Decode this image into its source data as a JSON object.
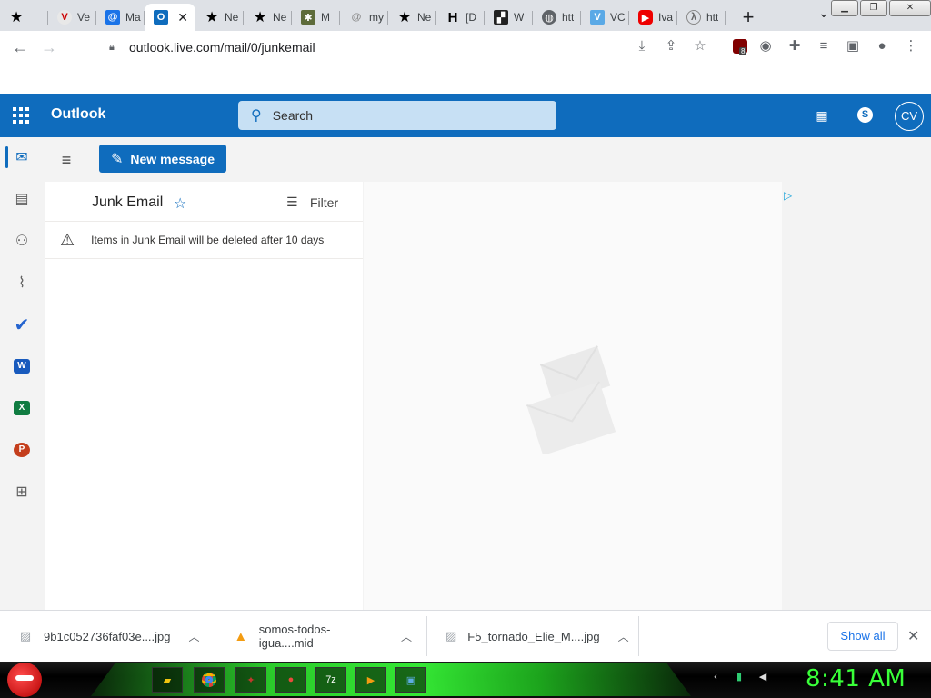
{
  "browser": {
    "tabs": [
      {
        "label": "",
        "icon": "star-icon"
      },
      {
        "label": "Ve",
        "icon": "vivaldi-icon"
      },
      {
        "label": "Ma",
        "icon": "at-mail-icon"
      },
      {
        "label": "",
        "icon": "outlook-icon",
        "active": true
      },
      {
        "label": "Ne",
        "icon": "star-icon"
      },
      {
        "label": "Ne",
        "icon": "star-icon"
      },
      {
        "label": "M",
        "icon": "bug-icon"
      },
      {
        "label": "my",
        "icon": "at-icon"
      },
      {
        "label": "Ne",
        "icon": "star-icon"
      },
      {
        "label": "[D",
        "icon": "h-letter-icon"
      },
      {
        "label": "W",
        "icon": "clapperboard-icon"
      },
      {
        "label": "htt",
        "icon": "globe-icon"
      },
      {
        "label": "VC",
        "icon": "v-letter-icon"
      },
      {
        "label": "Iva",
        "icon": "youtube-icon"
      },
      {
        "label": "htt",
        "icon": "lambda-icon"
      }
    ],
    "url": "outlook.live.com/mail/0/junkemail",
    "extension_badge": "8"
  },
  "outlook": {
    "brand": "Outlook",
    "search_placeholder": "Search",
    "avatar_initials": "CV",
    "new_message_label": "New message",
    "folder_title": "Junk Email",
    "filter_label": "Filter",
    "notice": "Items in Junk Email will be deleted after 10 days",
    "colors": {
      "header": "#0f6cbd",
      "search_bg": "#c7e0f4"
    }
  },
  "downloads": {
    "items": [
      {
        "name": "9b1c052736faf03e....jpg",
        "icon": "image-file-icon"
      },
      {
        "name": "somos-todos-igua....mid",
        "icon": "vlc-cone-icon"
      },
      {
        "name": "F5_tornado_Elie_M....jpg",
        "icon": "image-file-icon"
      }
    ],
    "show_all_label": "Show all"
  },
  "taskbar": {
    "clock": "8:41 AM"
  }
}
